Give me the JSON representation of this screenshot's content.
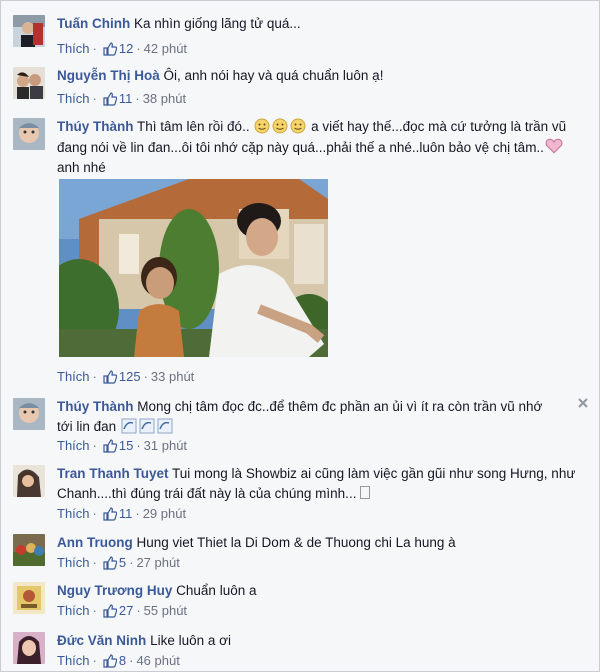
{
  "comments": [
    {
      "author": "Tuấn Chinh",
      "text": "Ka nhìn giống lãng tử quá...",
      "like": "Thích",
      "likes": "12",
      "time": "42 phút"
    },
    {
      "author": "Nguyễn Thị Hoà",
      "text": "Ôi, anh nói hay và quá chuẩn luôn ạ!",
      "like": "Thích",
      "likes": "11",
      "time": "38 phút"
    },
    {
      "author": "Thúy Thành",
      "text": "Thì tâm lên rồi đó..",
      "text2": "a viết hay thế...đọc mà cứ tưởng là trần vũ đang nói về lin đan...ôi tôi nhớ cặp này quá...phải thế a nhé..luôn bảo vệ chị tâm..",
      "text3": "anh nhé",
      "like": "Thích",
      "likes": "125",
      "time": "33 phút"
    },
    {
      "author": "Thúy Thành",
      "text": "Mong chị tâm đọc đc..để thêm đc phần an ủi vì ít ra còn trần vũ nhớ tới lin đan",
      "like": "Thích",
      "likes": "15",
      "time": "31 phút"
    },
    {
      "author": "Tran Thanh Tuyet",
      "text": "Tui mong là Showbiz ai cũng làm việc gần gũi như song Hưng, như Chanh....thì đúng trái đất này là của chúng mình...",
      "like": "Thích",
      "likes": "11",
      "time": "29 phút"
    },
    {
      "author": "Ann Truong",
      "text": "Hung viet Thiet la Di Dom & de Thuong chi La hung à",
      "like": "Thích",
      "likes": "5",
      "time": "27 phút"
    },
    {
      "author": "Nguy Trương Huy",
      "text": "Chuẩn luôn a",
      "like": "Thích",
      "likes": "27",
      "time": "55 phút"
    },
    {
      "author": "Đức Văn Ninh",
      "text": "Like luôn a ơi",
      "like": "Thích",
      "likes": "8",
      "time": "46 phút"
    }
  ],
  "colors": {
    "link": "#3b5998",
    "meta": "#6a7180",
    "background": "#f6f7f9"
  },
  "icons": {
    "like": "thumbs-up-icon",
    "smiley": "smiley-icon",
    "heart": "heart-icon",
    "close": "close-icon",
    "wave": "wave-emoji-icon"
  }
}
